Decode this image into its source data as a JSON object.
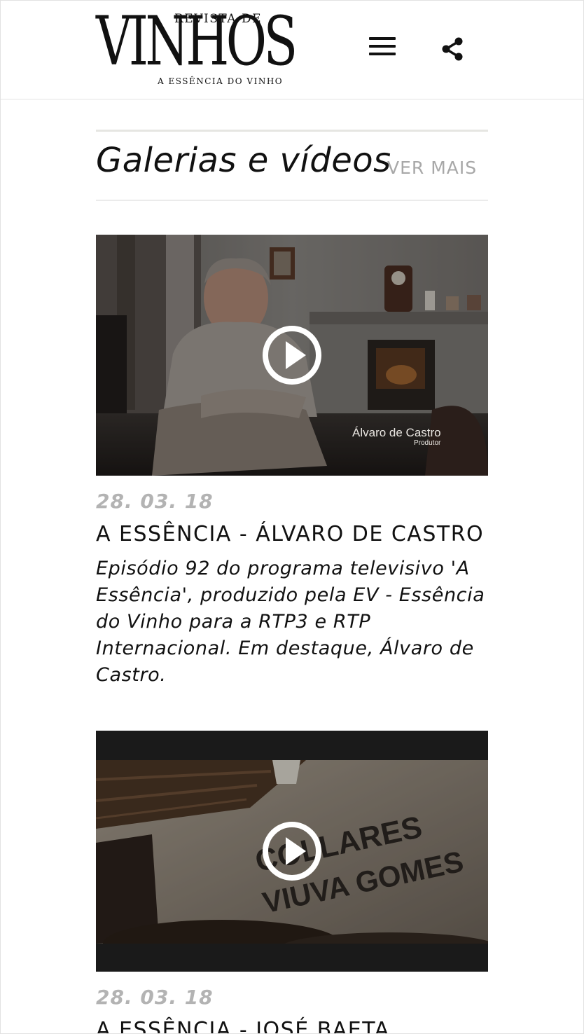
{
  "header": {
    "logo_top": "REVISTA DE",
    "logo_main": "VINHOS",
    "logo_bottom": "A ESSÊNCIA DO VINHO",
    "menu_icon": "hamburger-menu-icon",
    "share_icon": "share-icon"
  },
  "section": {
    "title": "Galerias e vídeos",
    "more_label": "VER MAIS"
  },
  "items": [
    {
      "date": "28. 03. 18",
      "title": "A ESSÊNCIA - ÁLVARO DE CASTRO",
      "description": "Episódio 92 do programa televisivo 'A Essência', produzido pela EV - Essência do Vinho para a RTP3 e RTP Internacional. Em destaque, Álvaro de Castro.",
      "caption_name": "Álvaro de Castro",
      "caption_role": "Produtor"
    },
    {
      "date": "28. 03. 18",
      "title": "A ESSÊNCIA - JOSÉ BAETA",
      "wall_text_1": "COLLARES",
      "wall_text_2": "VIUVA GOMES"
    }
  ],
  "colors": {
    "accent_text": "#111111",
    "muted": "#a8a8a8",
    "date": "#b3b3b3"
  }
}
